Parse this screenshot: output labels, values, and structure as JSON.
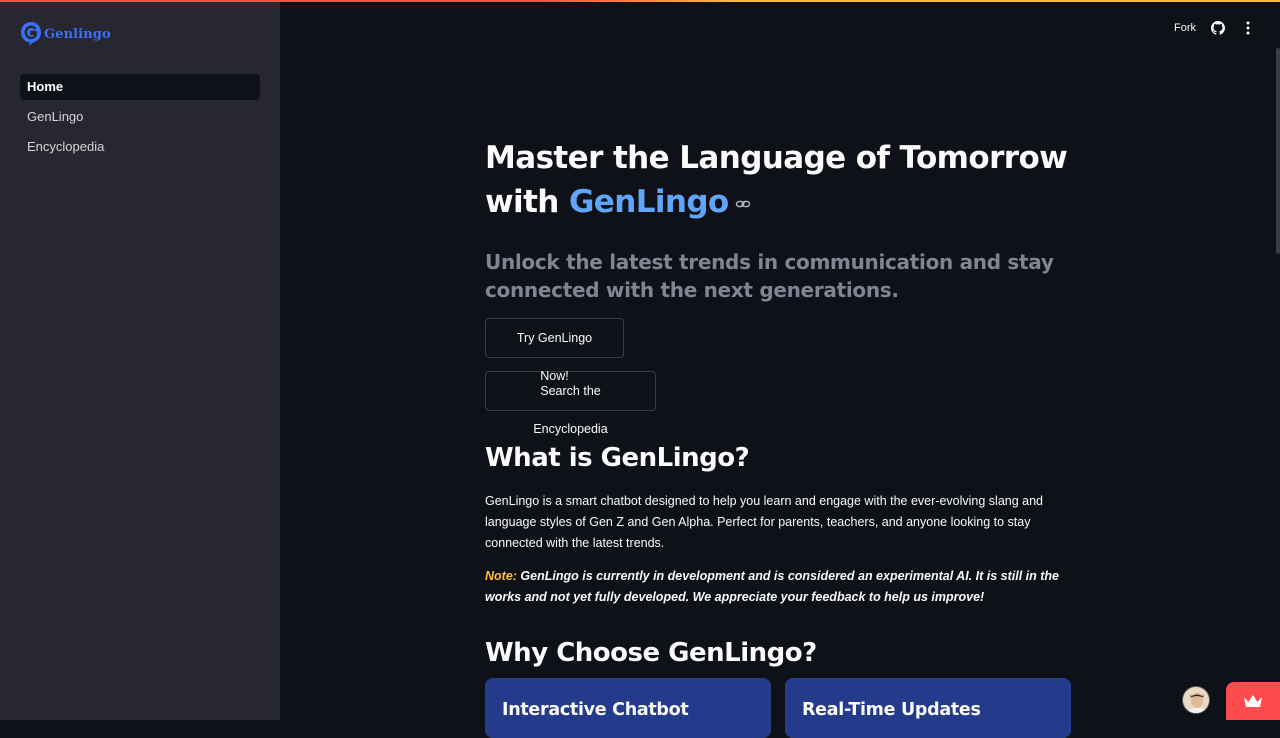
{
  "app": {
    "logo_text": "Genlingo"
  },
  "sidebar": {
    "items": [
      {
        "label": "Home"
      },
      {
        "label": "GenLingo"
      },
      {
        "label": "Encyclopedia"
      }
    ]
  },
  "header": {
    "fork_label": "Fork"
  },
  "hero": {
    "title_part1": "Master the Language of Tomorrow with ",
    "title_accent": "GenLingo",
    "subtitle": "Unlock the latest trends in communication and stay connected with the next generations."
  },
  "buttons": {
    "try_label": "Try GenLingo Now!",
    "search_label": "Search the Encyclopedia"
  },
  "what": {
    "heading": "What is GenLingo?",
    "paragraph": "GenLingo is a smart chatbot designed to help you learn and engage with the ever-evolving slang and language styles of Gen Z and Gen Alpha. Perfect for parents, teachers, and anyone looking to stay connected with the latest trends.",
    "note_label": "Note:",
    "note_text": " GenLingo is currently in development and is considered an experimental AI. It is still in the works and not yet fully developed. We appreciate your feedback to help us improve!"
  },
  "why": {
    "heading": "Why Choose GenLingo?",
    "cards": [
      {
        "title": "Interactive Chatbot"
      },
      {
        "title": "Real-Time Updates"
      }
    ]
  },
  "colors": {
    "accent": "#60a5fa",
    "note": "#ffbd45",
    "card": "#233b8a",
    "brand": "#3b6ff5",
    "streamlit_red": "#ff4b4b"
  },
  "icons": [
    "genlingo-logo-icon",
    "github-icon",
    "kebab-menu-icon",
    "link-icon",
    "crown-icon"
  ]
}
